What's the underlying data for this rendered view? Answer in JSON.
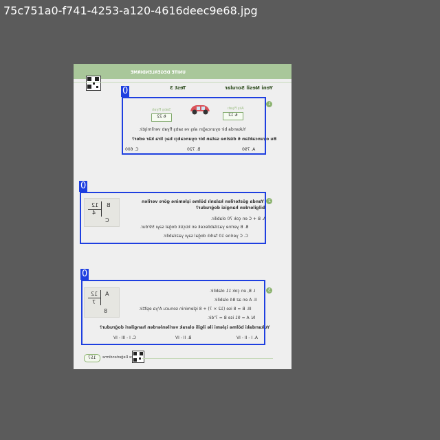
{
  "image_filename": "75c751a0-f741-4253-a120-4616deec9e68.jpg",
  "page": {
    "header_unit": "ÜNİTE DEĞERLENDİRME",
    "section_title": "Yeni Nesil Sorular",
    "test_title": "Test 3",
    "footer_page_number": "157",
    "footer_text": "Ünite Değerlendirme"
  },
  "q1": {
    "number": "1",
    "buy_price_label": "Alış Fiyatı",
    "buy_price": "₺ 12",
    "sell_price_label": "Satış Fiyatı",
    "sell_price": "₺ 22",
    "line1": "Yukarıda bir oyuncağın alış ve satış fiyatı verilmiştir.",
    "line2": "Bu oyuncaktan 6 düzine satan bir oyuncakçı kaç lira kâr eder?",
    "options": [
      "A. 790",
      "B. 720",
      "C. 600"
    ]
  },
  "q2": {
    "number": "2",
    "line1": "Yanda gösterilen kalanlı bölme işlemine göre verilen",
    "line2": "bilgilerden hangisi doğrudur?",
    "options": [
      "A. B + C en çok 70 olabilir.",
      "B. B yerine yazılabilecek en küçük doğal sayı 59'dur.",
      "C. C yerine 10 farklı doğal sayı yazılabilir."
    ],
    "division": {
      "dividend": "B",
      "divisor": "12",
      "quotient": "4",
      "remainder": "C"
    }
  },
  "q3": {
    "number": "3",
    "statements": [
      "I. B, en çok 11 olabilir.",
      "II. A en az 84 olabilir.",
      "III. B = 8 ise (12 × 7) + 8 işleminin sonucu A'ya eşittir.",
      "IV. A = 91 ise B = 7'dir."
    ],
    "line1": "Yukarıdaki bölme işlemi ile ilgili olarak verilenlerden hangileri doğrudur?",
    "options": [
      "A. I - II - IV",
      "B. II - IV",
      "C. I - III - IV"
    ],
    "division": {
      "dividend": "A",
      "divisor": "12",
      "quotient": "7",
      "remainder": "8"
    }
  },
  "annotations": [
    {
      "label": "0"
    },
    {
      "label": "0"
    },
    {
      "label": "0"
    }
  ]
}
